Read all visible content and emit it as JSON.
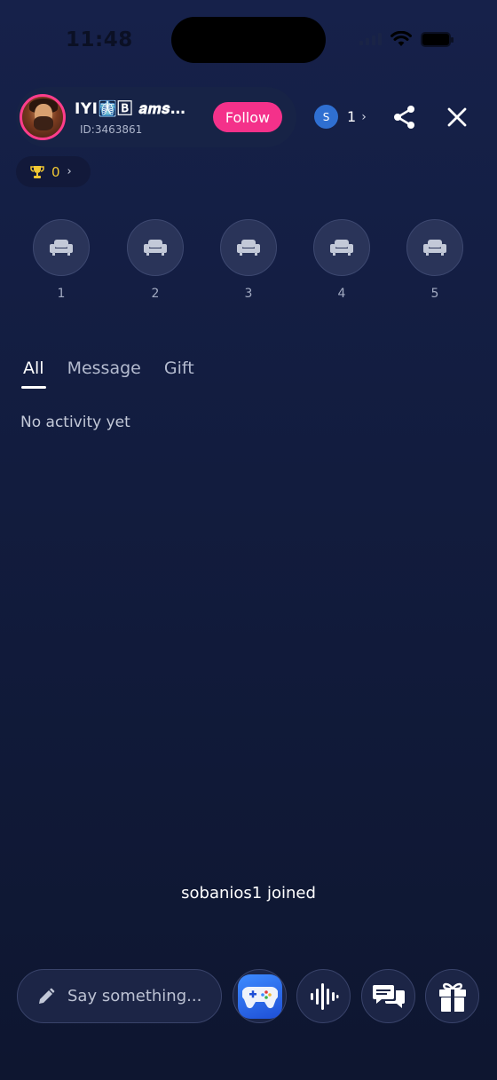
{
  "status_bar": {
    "time": "11:48"
  },
  "host": {
    "name": "IYI🩻🄱 𝒂𝒎𝒔𝒊...",
    "id": "ID:3463861",
    "follow_label": "Follow"
  },
  "viewers": {
    "avatar_letter": "S",
    "count": "1"
  },
  "trophy": {
    "count": "0"
  },
  "seats": [
    {
      "number": "1",
      "icon": "sofa-icon"
    },
    {
      "number": "2",
      "icon": "sofa-icon"
    },
    {
      "number": "3",
      "icon": "sofa-icon"
    },
    {
      "number": "4",
      "icon": "sofa-icon"
    },
    {
      "number": "5",
      "icon": "sofa-icon"
    }
  ],
  "tabs": [
    {
      "label": "All",
      "active": true
    },
    {
      "label": "Message",
      "active": false
    },
    {
      "label": "Gift",
      "active": false
    }
  ],
  "activity": {
    "empty_text": "No activity yet"
  },
  "join_message": "sobanios1 joined",
  "composer": {
    "placeholder": "Say something..."
  },
  "actions": [
    "gamepad-icon",
    "voice-wave-icon",
    "chat-icon",
    "gift-icon"
  ],
  "colors": {
    "follow": "#f4318a",
    "trophy": "#f3c933",
    "viewer_avatar": "#2f6fd1",
    "background": "#121c3e"
  }
}
